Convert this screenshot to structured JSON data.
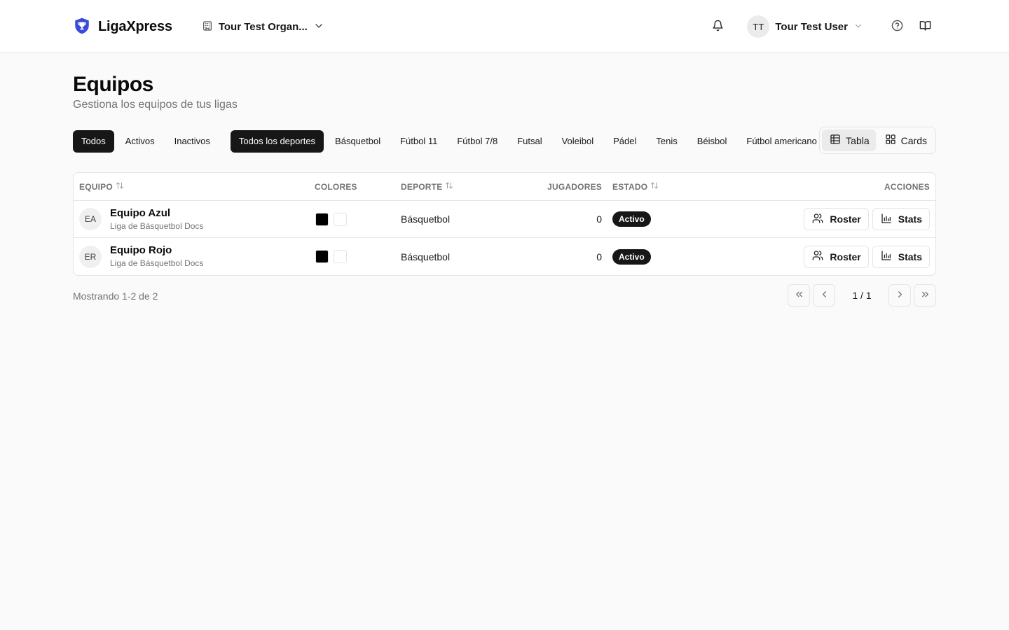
{
  "app": {
    "brand": "LigaXpress",
    "accent": "#3b4bd8"
  },
  "header": {
    "organization": "Tour Test Organ...",
    "user_initials": "TT",
    "user_name": "Tour Test User"
  },
  "page": {
    "title": "Equipos",
    "subtitle": "Gestiona los equipos de tus ligas"
  },
  "status_filters": [
    {
      "label": "Todos",
      "active": true
    },
    {
      "label": "Activos",
      "active": false
    },
    {
      "label": "Inactivos",
      "active": false
    }
  ],
  "sport_filters": [
    {
      "label": "Todos los deportes",
      "active": true
    },
    {
      "label": "Básquetbol",
      "active": false
    },
    {
      "label": "Fútbol 11",
      "active": false
    },
    {
      "label": "Fútbol 7/8",
      "active": false
    },
    {
      "label": "Futsal",
      "active": false
    },
    {
      "label": "Voleibol",
      "active": false
    },
    {
      "label": "Pádel",
      "active": false
    },
    {
      "label": "Tenis",
      "active": false
    },
    {
      "label": "Béisbol",
      "active": false
    },
    {
      "label": "Fútbol americano",
      "active": false
    }
  ],
  "view_toggle": {
    "table_label": "Tabla",
    "cards_label": "Cards",
    "selected": "table"
  },
  "table": {
    "columns": {
      "team": "EQUIPO",
      "colors": "COLORES",
      "sport": "DEPORTE",
      "players": "JUGADORES",
      "status": "ESTADO",
      "actions": "ACCIONES"
    },
    "rows": [
      {
        "initials": "EA",
        "name": "Equipo Azul",
        "league": "Liga de Básquetbol Docs",
        "primary_color": "#000000",
        "secondary_color": "#ffffff",
        "sport": "Básquetbol",
        "players": "0",
        "status": "Activo",
        "roster_label": "Roster",
        "stats_label": "Stats"
      },
      {
        "initials": "ER",
        "name": "Equipo Rojo",
        "league": "Liga de Básquetbol Docs",
        "primary_color": "#000000",
        "secondary_color": "#ffffff",
        "sport": "Básquetbol",
        "players": "0",
        "status": "Activo",
        "roster_label": "Roster",
        "stats_label": "Stats"
      }
    ]
  },
  "pagination": {
    "showing": "Mostrando 1-2 de 2",
    "page_info": "1 / 1"
  }
}
